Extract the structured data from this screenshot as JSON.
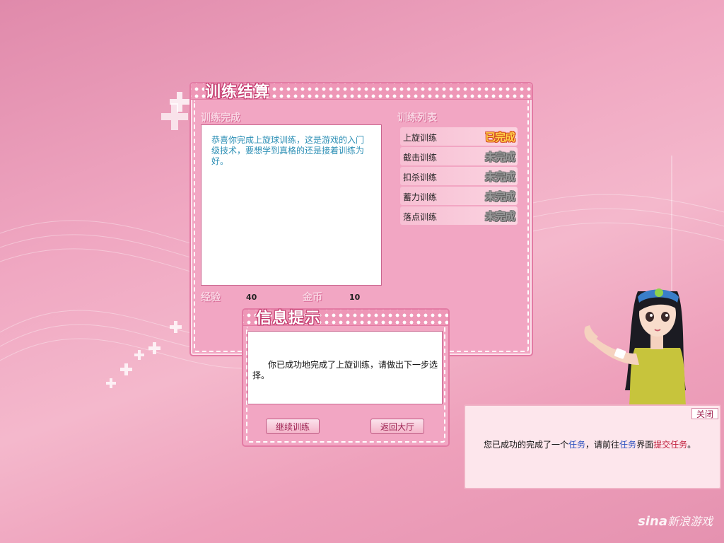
{
  "colors": {
    "panel_pink": "#f2a6c3",
    "completed_badge": "#ffd24a",
    "incomplete_badge": "#9a9a9a",
    "message_text": "#2c8fb5",
    "highlight_blue": "#2a4fbf",
    "highlight_red": "#c01d3a"
  },
  "training_panel": {
    "title": "训练结算",
    "section_complete": "训练完成",
    "section_list": "训练列表",
    "message": "恭喜你完成上旋球训练，这是游戏的入门级技术，要想学到真格的还是接着训练为好。",
    "experience_label": "经验",
    "experience_value": "40",
    "gold_label": "金币",
    "gold_value": "10",
    "items": [
      {
        "label": "上旋训练",
        "status": "已完成"
      },
      {
        "label": "截击训练",
        "status": "未完成"
      },
      {
        "label": "扣杀训练",
        "status": "未完成"
      },
      {
        "label": "蓄力训练",
        "status": "未完成"
      },
      {
        "label": "落点训练",
        "status": "未完成"
      }
    ]
  },
  "info_dialog": {
    "title": "信息提示",
    "message": "你已成功地完成了上旋训练，请做出下一步选择。",
    "continue_button": "继续训练",
    "return_button": "返回大厅"
  },
  "task_notice": {
    "close_label": "关闭",
    "text_1": "您已成功的完成了一个",
    "link_task": "任务",
    "text_2": "，请前往",
    "link_task_2": "任务",
    "text_3": "界面",
    "link_submit": "提交任务",
    "text_4": "。"
  },
  "watermark": {
    "brand": "sina",
    "text": "新浪游戏"
  }
}
